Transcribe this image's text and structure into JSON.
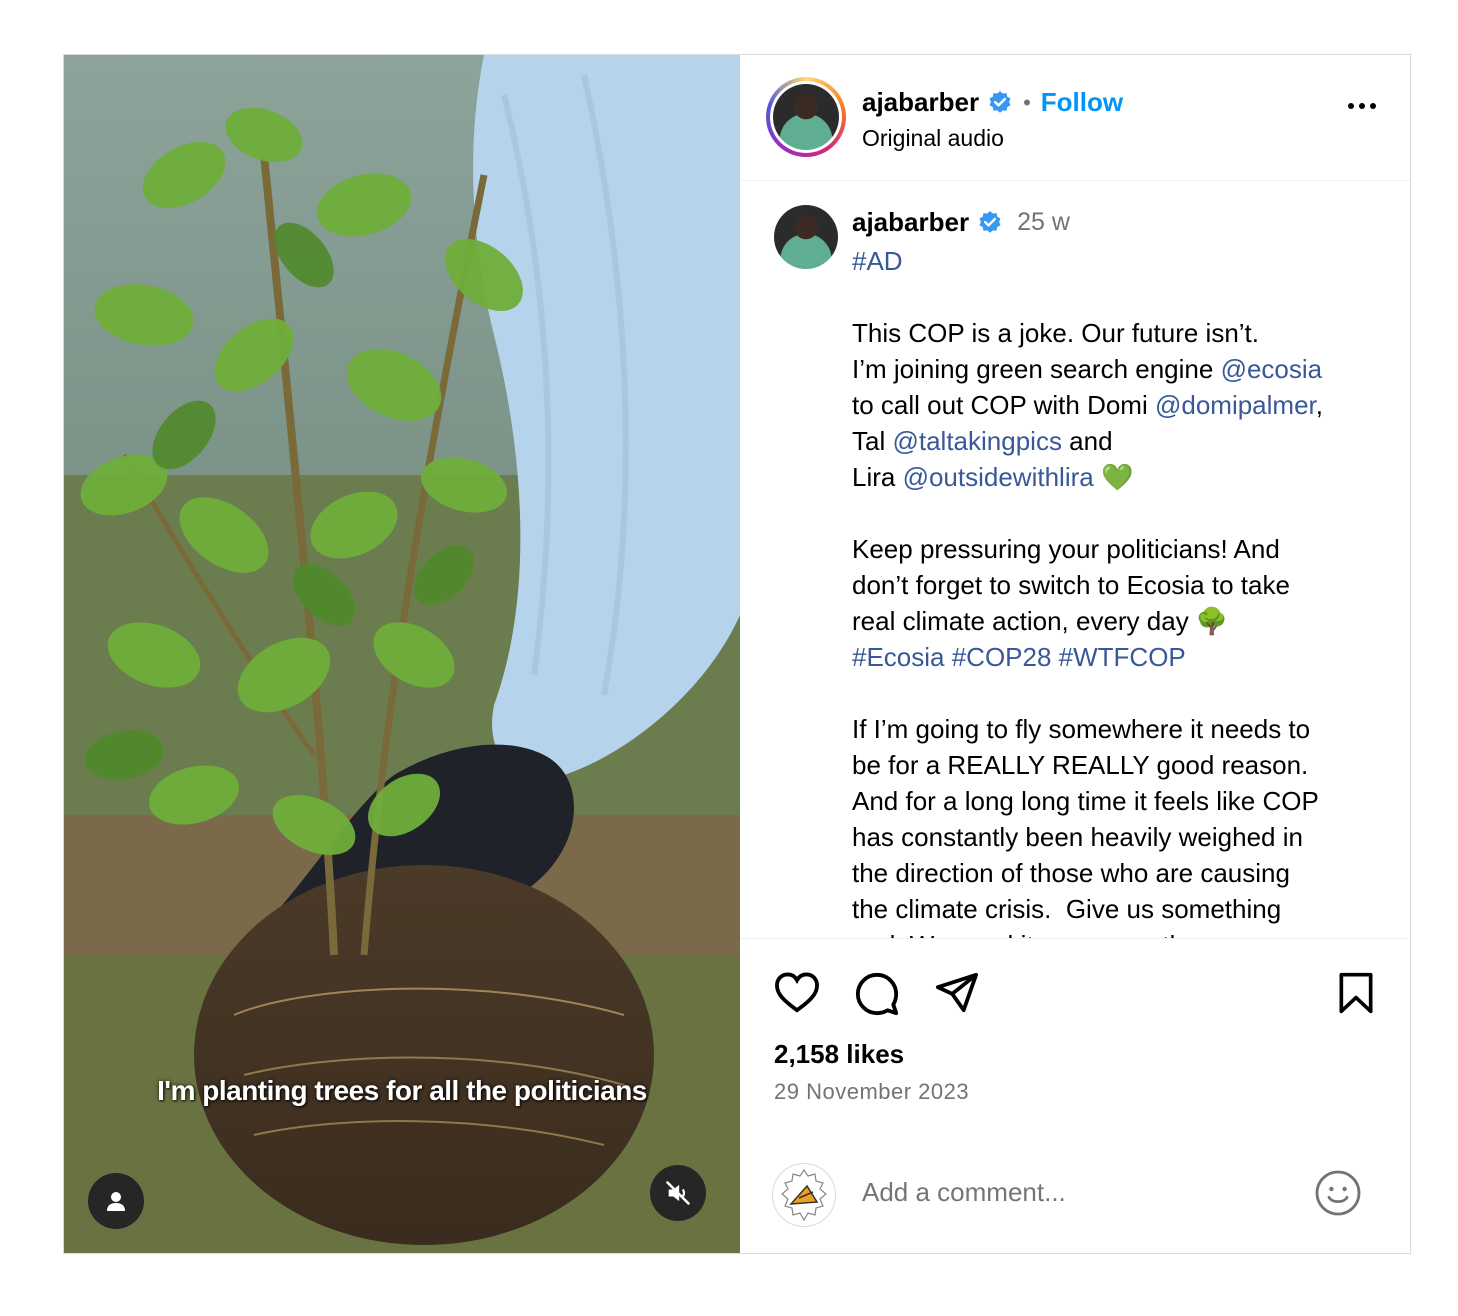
{
  "media": {
    "overlay_caption": "I'm planting trees for all the politicians",
    "user_button_icon": "user-icon",
    "mute_button_icon": "muted-speaker-icon"
  },
  "header": {
    "username": "ajabarber",
    "verified_icon": "verified-badge-icon",
    "separator": "•",
    "follow_label": "Follow",
    "subtitle": "Original audio",
    "more_icon": "more-options-icon"
  },
  "caption": {
    "username": "ajabarber",
    "time": "25 w",
    "tag_ad": "#AD",
    "p1_line1": "This COP is a joke. Our future isn’t.",
    "p1_line2_a": "I’m joining green search engine ",
    "p1_line2_mention": "@ecosia",
    "p1_line3_a": "to call out COP with Domi ",
    "p1_line3_mention": "@domipalmer",
    "p1_line3_b": ",",
    "p1_line4_a": "Tal ",
    "p1_line4_mention": "@taltakingpics",
    "p1_line4_b": " and",
    "p1_line5_a": "Lira ",
    "p1_line5_mention": "@outsidewithlira",
    "p1_line5_emoji": "💚",
    "p2_line1": "Keep pressuring your politicians! And",
    "p2_line2": "don’t forget to switch to Ecosia to take",
    "p2_line3": "real climate action, every day 🌳",
    "p2_tags": "#Ecosia #COP28 #WTFCOP",
    "p3_line1": "If I’m going to fly somewhere it needs to",
    "p3_line2": "be for a REALLY REALLY good reason.",
    "p3_line3": "And for a long long time it feels like COP",
    "p3_line4": "has constantly been heavily weighed in",
    "p3_line5": "the direction of those who are causing",
    "p3_line6": "the climate crisis.  Give us something",
    "p3_line7": "real. We need it now more than ever."
  },
  "actions": {
    "like_icon": "heart-icon",
    "comment_icon": "comment-bubble-icon",
    "share_icon": "paper-plane-icon",
    "save_icon": "bookmark-icon",
    "likes": "2,158 likes",
    "date": "29 November 2023"
  },
  "comment_box": {
    "placeholder": "Add a comment...",
    "emoji_icon": "smiley-icon"
  },
  "colors": {
    "link": "#385898",
    "follow": "#0095f6",
    "verified": "#3897f0",
    "muted": "#737373"
  }
}
